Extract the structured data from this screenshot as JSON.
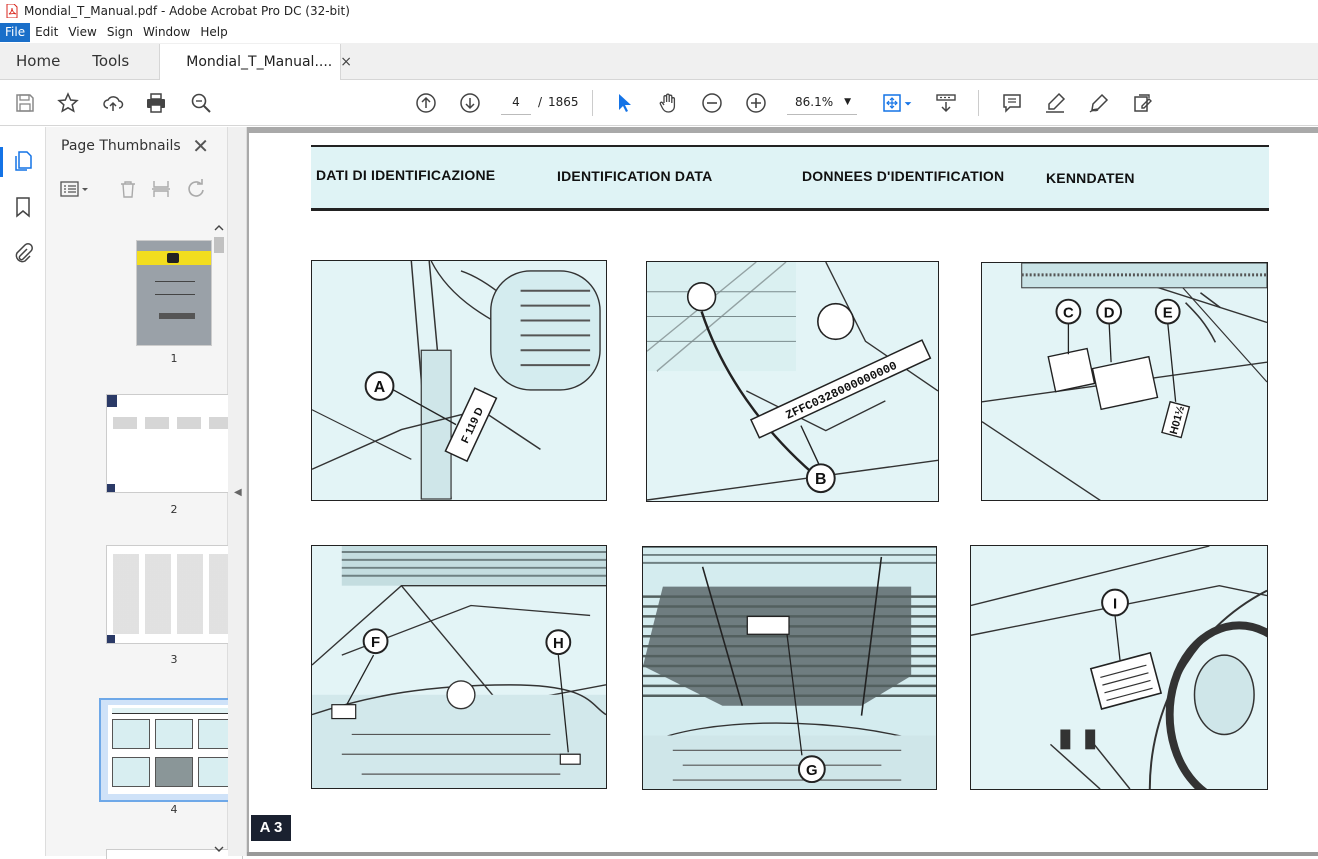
{
  "window": {
    "title": "Mondial_T_Manual.pdf - Adobe Acrobat Pro DC (32-bit)"
  },
  "menu": {
    "items": [
      "File",
      "Edit",
      "View",
      "Sign",
      "Window",
      "Help"
    ]
  },
  "tabs": {
    "home": "Home",
    "tools": "Tools",
    "document": "Mondial_T_Manual....",
    "close_glyph": "×"
  },
  "toolbar": {
    "page_current": "4",
    "page_separator": "/",
    "page_total": "1865",
    "zoom": "86.1%",
    "icons": [
      "save-icon",
      "bookmark-star-icon",
      "upload-icon",
      "print-icon",
      "search-zoom-icon",
      "page-up-icon",
      "page-down-icon",
      "select-cursor-icon",
      "hand-icon",
      "zoom-out-icon",
      "zoom-in-icon",
      "fit-page-icon",
      "scroll-mode-icon",
      "comment-icon",
      "highlight-icon",
      "sign-icon",
      "edit-icon"
    ]
  },
  "sidebar": {
    "panel_title": "Page Thumbnails",
    "close_glyph": "✕",
    "thumbnails": [
      {
        "label": "1"
      },
      {
        "label": "2"
      },
      {
        "label": "3"
      },
      {
        "label": "4",
        "selected": true
      }
    ]
  },
  "document": {
    "headings": [
      "DATI DI IDENTIFICAZIONE",
      "IDENTIFICATION DATA",
      "DONNEES D'IDENTIFICATION",
      "KENNDATEN"
    ],
    "callouts": [
      "A",
      "B",
      "C",
      "D",
      "E",
      "F",
      "H",
      "G",
      "I"
    ],
    "plate_texts": {
      "b": "ZFFC0328000000000",
      "a": "F 119 D",
      "e": "H01½"
    },
    "page_tag": "A 3"
  },
  "colors": {
    "accent": "#1473e6",
    "menu_active": "#1a6fc9",
    "photo_bg": "#e3f4f6",
    "header_bg": "#dff3f5"
  }
}
